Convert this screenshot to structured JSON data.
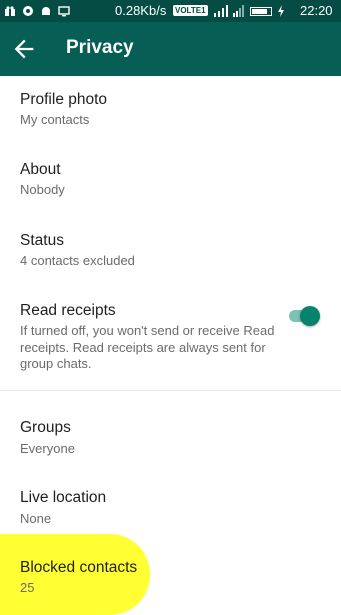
{
  "status_bar": {
    "network_speed": "0.28Kb/s",
    "volte_badge": "VOLTE1",
    "time": "22:20"
  },
  "app_bar": {
    "title": "Privacy",
    "back_icon": "arrow-back-icon"
  },
  "settings": {
    "profile_photo": {
      "label": "Profile photo",
      "value": "My contacts"
    },
    "about": {
      "label": "About",
      "value": "Nobody"
    },
    "status": {
      "label": "Status",
      "value": "4 contacts excluded"
    },
    "read_receipts": {
      "label": "Read receipts",
      "description": "If turned off, you won't send or receive Read receipts. Read receipts are always sent for group chats.",
      "enabled": true
    },
    "groups": {
      "label": "Groups",
      "value": "Everyone"
    },
    "live_location": {
      "label": "Live location",
      "value": "None"
    },
    "blocked_contacts": {
      "label": "Blocked contacts",
      "value": "25"
    }
  },
  "colors": {
    "status_bar": "#054d44",
    "app_bar": "#075e54",
    "toggle_on": "#07826b",
    "highlight": "#ffff33"
  }
}
